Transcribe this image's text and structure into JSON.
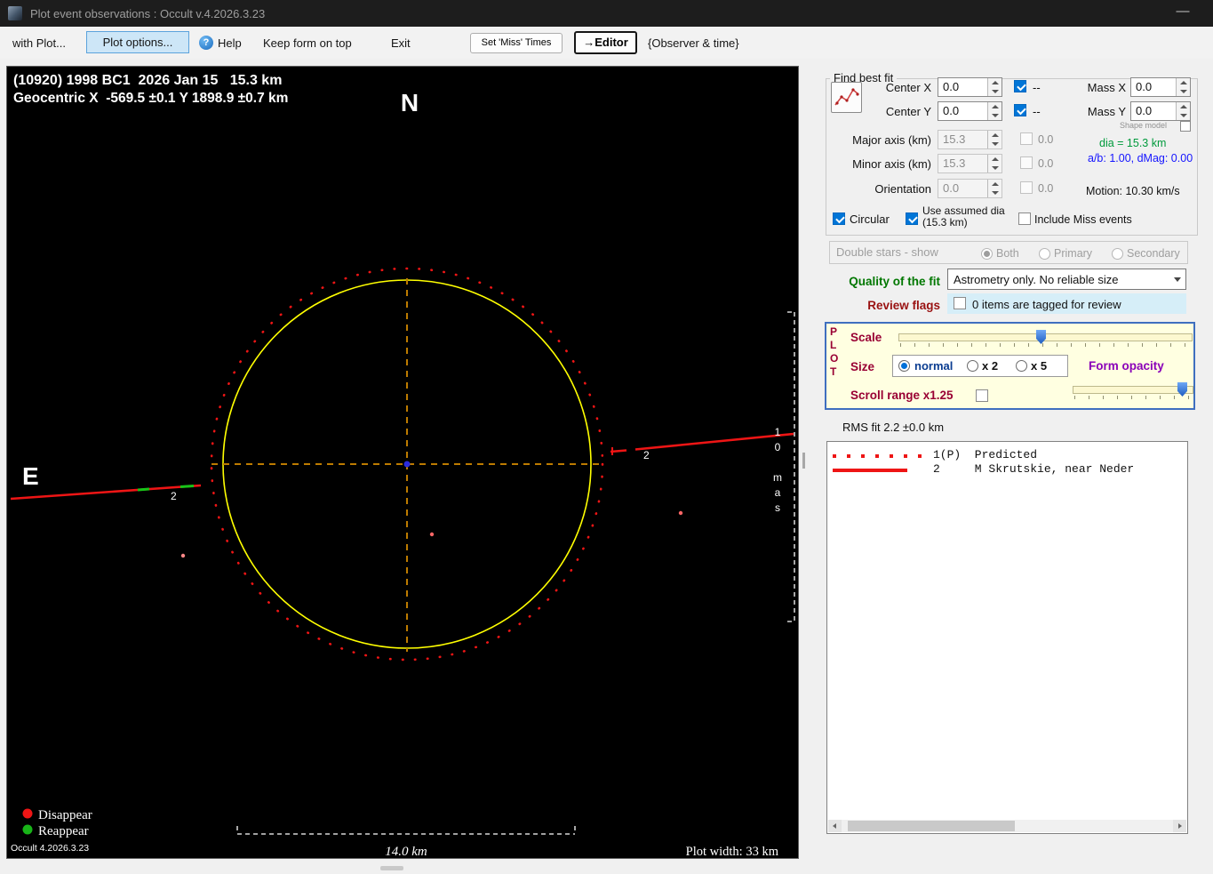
{
  "window": {
    "title": "Plot event observations : Occult v.4.2026.3.23",
    "minimize_glyph": "—"
  },
  "menubar": {
    "with_plot": "with Plot...",
    "plot_options": "Plot options...",
    "help_icon": "?",
    "help": "Help",
    "keep_on_top": "Keep form on top",
    "exit": "Exit",
    "set_miss_times": "Set 'Miss' Times",
    "editor": "→Editor",
    "observer_time": "{Observer & time}"
  },
  "plot": {
    "title_line1": "(10920) 1998 BC1  2026 Jan 15   15.3 km",
    "title_line2": "Geocentric X  -569.5 ±0.1 Y 1898.9 ±0.7 km",
    "north": "N",
    "east": "E",
    "left_chord_label": "2",
    "right_chord_label": "2",
    "mas_scale": "10 mas",
    "km_scale": "14.0 km",
    "legend_disappear": "Disappear",
    "legend_reappear": "Reappear",
    "version": "Occult 4.2026.3.23",
    "width_label": "Plot width: 33 km"
  },
  "find_best_fit": {
    "legend": "Find best fit",
    "center_x_label": "Center X",
    "center_x_value": "0.0",
    "center_x_dash": "--",
    "mass_x_label": "Mass X",
    "mass_x_value": "0.0",
    "center_y_label": "Center Y",
    "center_y_value": "0.0",
    "center_y_dash": "--",
    "mass_y_label": "Mass Y",
    "mass_y_value": "0.0",
    "shape_model_label": "Shape model",
    "major_axis_label": "Major axis (km)",
    "major_axis_value": "15.3",
    "major_axis_err": "0.0",
    "dia_text": "dia = 15.3 km",
    "minor_axis_label": "Minor axis (km)",
    "minor_axis_value": "15.3",
    "minor_axis_err": "0.0",
    "ab_text": "a/b: 1.00, dMag: 0.00",
    "orientation_label": "Orientation",
    "orientation_value": "0.0",
    "orientation_err": "0.0",
    "motion_text": "Motion: 10.30 km/s",
    "circular_label": "Circular",
    "use_assumed_label": "Use assumed dia (15.3 km)",
    "include_miss_label": "Include Miss events"
  },
  "double_stars": {
    "legend": "Double stars - show",
    "both": "Both",
    "primary": "Primary",
    "secondary": "Secondary"
  },
  "quality_fit": {
    "label": "Quality of the fit",
    "value": "Astrometry only. No reliable size"
  },
  "review_flags": {
    "label": "Review flags",
    "text": "0 items are tagged for review"
  },
  "plot_controls": {
    "letters": [
      "P",
      "L",
      "O",
      "T"
    ],
    "scale_label": "Scale",
    "size_label": "Size",
    "size_normal": "normal",
    "size_x2": "x 2",
    "size_x5": "x 5",
    "form_opacity": "Form opacity",
    "scroll_range_label": "Scroll range x1.25"
  },
  "rms_label": "RMS fit 2.2 ±0.0 km",
  "observations": {
    "rows": [
      {
        "label": "1(P)  Predicted",
        "line_style": "dotted"
      },
      {
        "label": "2     M Skrutskie, near Neder",
        "line_style": "solid"
      }
    ]
  },
  "colors": {
    "predicted_red": "#ee1515",
    "circle_yellow": "#ffff00",
    "crosshair_orange": "#bd7b00",
    "accent_blue": "#0075d7",
    "quality_green": "#007700",
    "review_maroon": "#991111",
    "panel_maroon": "#990033",
    "opacity_purple": "#8a00b8"
  }
}
